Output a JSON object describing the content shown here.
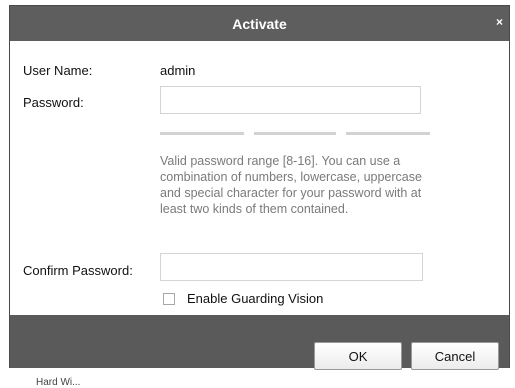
{
  "dialog": {
    "title": "Activate",
    "close_glyph": "×"
  },
  "form": {
    "user_name_label": "User Name:",
    "user_name_value": "admin",
    "password_label": "Password:",
    "password_value": "",
    "strength_bars": 3,
    "hint": "Valid password range [8-16]. You can use a combination of numbers, lowercase, uppercase and special character for your password with at least two kinds of them contained.",
    "confirm_label": "Confirm Password:",
    "confirm_value": "",
    "guarding_label": "Enable Guarding Vision",
    "guarding_checked": false
  },
  "buttons": {
    "ok": "OK",
    "cancel": "Cancel"
  },
  "below_fragment": "Hard Wi...",
  "colors": {
    "titlebar": "#5e5e5e",
    "footer": "#5a5a5a",
    "hint_text": "#7a7a7a",
    "strength_bar": "#d2d2d2"
  }
}
